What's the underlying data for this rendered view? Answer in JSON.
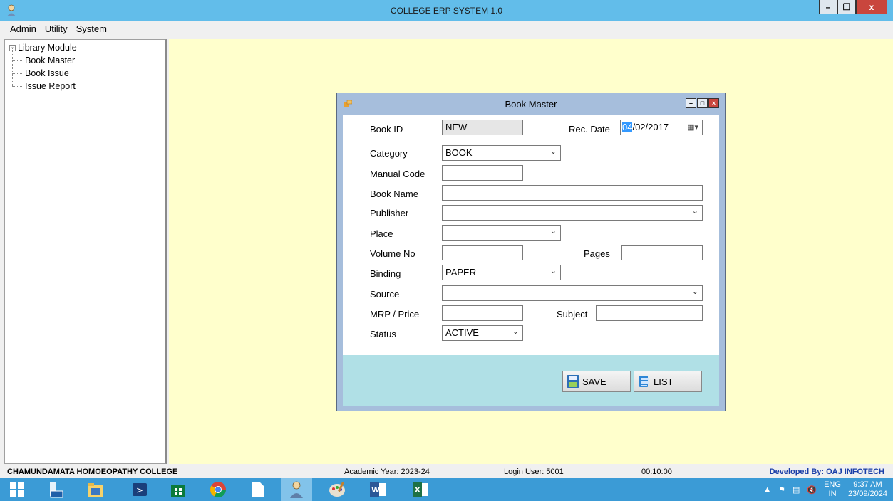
{
  "window": {
    "title": "COLLEGE ERP SYSTEM 1.0"
  },
  "menu": [
    "Admin",
    "Utility",
    "System"
  ],
  "tree": {
    "root": "Library Module",
    "children": [
      "Book Master",
      "Book Issue",
      "Issue Report"
    ]
  },
  "book_master": {
    "title": "Book Master",
    "labels": {
      "book_id": "Book ID",
      "rec_date": "Rec. Date",
      "category": "Category",
      "manual_code": "Manual Code",
      "book_name": "Book Name",
      "publisher": "Publisher",
      "place": "Place",
      "volume_no": "Volume No",
      "pages": "Pages",
      "binding": "Binding",
      "source": "Source",
      "mrp_price": "MRP / Price",
      "subject": "Subject",
      "status": "Status"
    },
    "values": {
      "book_id": "NEW",
      "rec_date_day": "04",
      "rec_date_rest": "/02/2017",
      "category": "BOOK",
      "manual_code": "",
      "book_name": "",
      "publisher": "",
      "place": "",
      "volume_no": "",
      "pages": "",
      "binding": "PAPER",
      "source": "",
      "mrp_price": "",
      "subject": "",
      "status": "ACTIVE"
    },
    "buttons": {
      "save": "SAVE",
      "list": "LIST"
    }
  },
  "statusbar": {
    "college": "CHAMUNDAMATA HOMOEOPATHY COLLEGE",
    "academic_year": "Academic Year: 2023-24",
    "login_user": "Login User: 5001",
    "timer": "00:10:00",
    "developer": "Developed By: OAJ INFOTECH"
  },
  "taskbar": {
    "lang_top": "ENG",
    "lang_bottom": "IN",
    "time": "9:37 AM",
    "date": "23/09/2024"
  },
  "colors": {
    "title_bar": "#62bdea",
    "mdi_background": "#ffffcc",
    "child_frame": "#a6bedc",
    "footer_panel": "#b0e0e6",
    "taskbar": "#3b9bd6",
    "developer_text": "#1a3ea8"
  }
}
